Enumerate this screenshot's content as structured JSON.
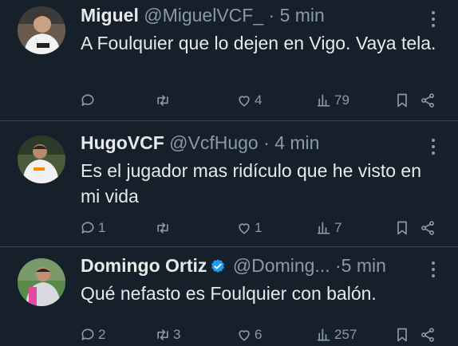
{
  "tweets": [
    {
      "name": "Miguel",
      "handle": "@MiguelVCF_",
      "separator": "·",
      "time": "5 min",
      "verified": false,
      "text": "A Foulquier que lo dejen en Vigo. Vaya tela.",
      "replies": "",
      "retweets": "",
      "likes": "4",
      "views": "79"
    },
    {
      "name": "HugoVCF",
      "handle": "@VcfHugo",
      "separator": "·",
      "time": "4 min",
      "verified": false,
      "text": "Es el jugador mas ridículo que he visto en mi vida",
      "replies": "1",
      "retweets": "",
      "likes": "1",
      "views": "7"
    },
    {
      "name": "Domingo Ortiz",
      "handle": "@Doming...",
      "separator": "·",
      "time": "5 min",
      "verified": true,
      "text": "Qué nefasto es Foulquier con balón.",
      "replies": "2",
      "retweets": "3",
      "likes": "6",
      "views": "257"
    }
  ],
  "colors": {
    "background": "#15202b",
    "divider": "#38444d",
    "text_primary": "#e7e9ea",
    "text_secondary": "#8b98a5",
    "verified": "#1d9bf0"
  }
}
